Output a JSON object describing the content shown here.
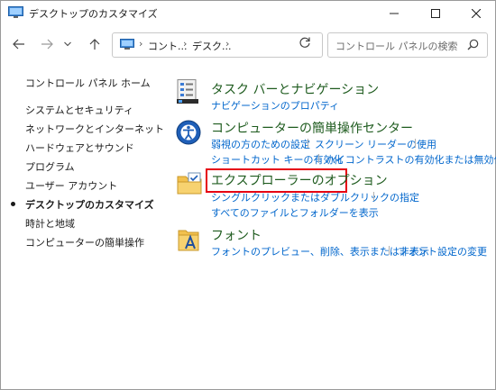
{
  "window": {
    "title": "デスクトップのカスタマイズ"
  },
  "address": {
    "crumbs": [
      "コント...",
      "デスク..."
    ]
  },
  "search": {
    "placeholder": "コントロール パネルの検索"
  },
  "leftnav": {
    "home": "コントロール パネル ホーム",
    "items": [
      {
        "label": "システムとセキュリティ",
        "active": false
      },
      {
        "label": "ネットワークとインターネット",
        "active": false
      },
      {
        "label": "ハードウェアとサウンド",
        "active": false
      },
      {
        "label": "プログラム",
        "active": false
      },
      {
        "label": "ユーザー アカウント",
        "active": false
      },
      {
        "label": "デスクトップのカスタマイズ",
        "active": true
      },
      {
        "label": "時計と地域",
        "active": false
      },
      {
        "label": "コンピューターの簡単操作",
        "active": false
      }
    ]
  },
  "categories": [
    {
      "title": "タスク バーとナビゲーション",
      "icon": "taskbar-icon",
      "links": [
        "ナビゲーションのプロパティ"
      ]
    },
    {
      "title": "コンピューターの簡単操作センター",
      "icon": "ease-of-access-icon",
      "links": [
        "弱視の方のための設定",
        "スクリーン リーダーの使用",
        "ショートカット キーの有効化",
        "ハイコントラストの有効化または無効化"
      ]
    },
    {
      "title": "エクスプローラーのオプション",
      "icon": "folder-options-icon",
      "links": [
        "シングルクリックまたはダブルクリックの指定",
        "すべてのファイルとフォルダーを表示"
      ]
    },
    {
      "title": "フォント",
      "icon": "fonts-folder-icon",
      "links": [
        "フォントのプレビュー、削除、表示または非表示",
        "フォント設定の変更"
      ]
    }
  ],
  "colors": {
    "category_title": "#1e5b1e",
    "link": "#0066cc",
    "highlight": "#e60012"
  }
}
